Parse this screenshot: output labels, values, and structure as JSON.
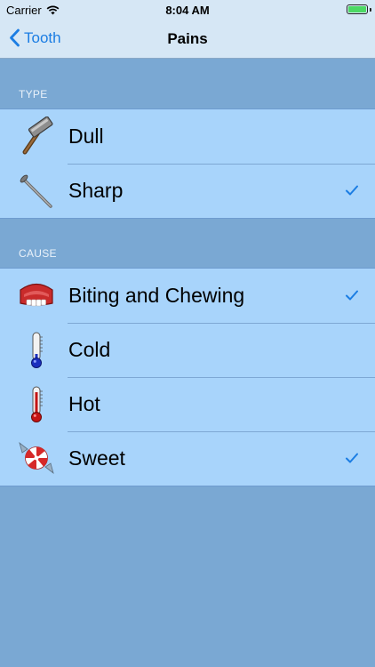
{
  "status_bar": {
    "carrier": "Carrier",
    "time": "8:04 AM",
    "battery_level": 1.0
  },
  "nav": {
    "back_label": "Tooth",
    "title": "Pains"
  },
  "sections": [
    {
      "header": "TYPE",
      "items": [
        {
          "label": "Dull",
          "icon": "hammer-icon",
          "checked": false
        },
        {
          "label": "Sharp",
          "icon": "nail-icon",
          "checked": true
        }
      ]
    },
    {
      "header": "CAUSE",
      "items": [
        {
          "label": "Biting and Chewing",
          "icon": "dentures-icon",
          "checked": true
        },
        {
          "label": "Cold",
          "icon": "cold-thermometer-icon",
          "checked": false
        },
        {
          "label": "Hot",
          "icon": "hot-thermometer-icon",
          "checked": false
        },
        {
          "label": "Sweet",
          "icon": "candy-icon",
          "checked": true
        }
      ]
    }
  ],
  "colors": {
    "background": "#7aa8d3",
    "row_background": "#a8d4fb",
    "nav_background": "#d6e7f5",
    "accent": "#1b7de3"
  }
}
